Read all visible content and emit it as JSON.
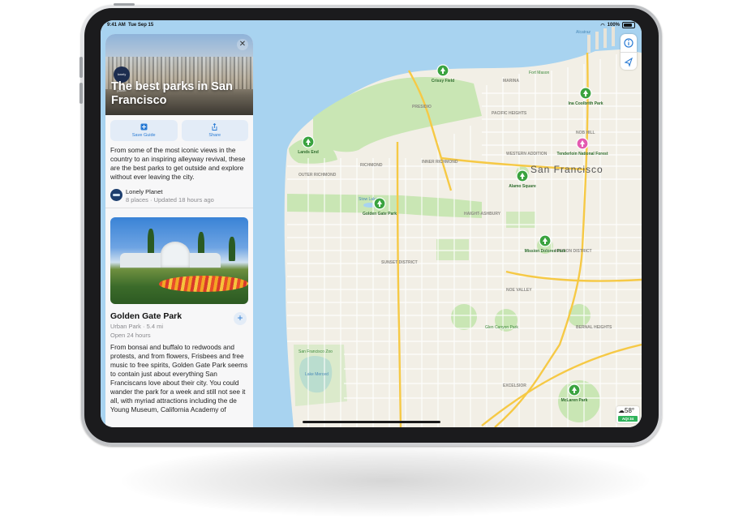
{
  "status": {
    "time": "9:41 AM",
    "date": "Tue Sep 15",
    "battery": "100%"
  },
  "guide": {
    "publisher_logo": "lonely planet",
    "title": "The best parks in San Francisco",
    "close_icon": "close-icon",
    "save_label": "Save Guide",
    "share_label": "Share",
    "description": "From some of the most iconic views in the country to an inspiring alleyway revival, these are the best parks to get outside and explore without ever leaving the city.",
    "author": "Lonely Planet",
    "meta": "8 places · Updated 18 hours ago"
  },
  "place": {
    "name": "Golden Gate Park",
    "type": "Urban Park · 5.4 mi",
    "hours": "Open 24 hours",
    "description": "From bonsai and buffalo to redwoods and protests, and from flowers, Frisbees and free music to free spirits, Golden Gate Park seems to contain just about everything San Franciscans love about their city. You could wander the park for a week and still not see it all, with myriad attractions including the de Young Museum, California Academy of"
  },
  "map": {
    "city": "San Francisco",
    "parks": [
      {
        "name": "Crissy Field"
      },
      {
        "name": "Lands End"
      },
      {
        "name": "Golden Gate Park"
      },
      {
        "name": "Alamo Square"
      },
      {
        "name": "Ina Coolbrith Park"
      },
      {
        "name": "Tenderloin National Forest"
      },
      {
        "name": "Mission Dolores Park"
      },
      {
        "name": "McLaren Park"
      }
    ],
    "labels": {
      "fort_mason": "Fort Mason",
      "marina": "MARINA",
      "presidio": "PRESIDIO",
      "richmond": "RICHMOND",
      "outer_richmond": "OUTER RICHMOND",
      "inner_richmond": "INNER RICHMOND",
      "sunset": "SUNSET DISTRICT",
      "haight": "HAIGHT-ASHBURY",
      "mission": "MISSION DISTRICT",
      "nob_hill": "NOB HILL",
      "pacific_heights": "PACIFIC HEIGHTS",
      "western_addition": "WESTERN ADDITION",
      "noe_valley": "NOE VALLEY",
      "bernal": "BERNAL HEIGHTS",
      "excelsior": "EXCELSIOR",
      "lake_merced": "Lake Merced",
      "stow_lake": "Stow Lake",
      "glen_canyon": "Glen Canyon Park",
      "sf_zoo": "San Francisco Zoo",
      "alcatraz": "Alcatraz"
    },
    "weather": {
      "temp": "58°",
      "aqi": "AQI 34"
    }
  },
  "colors": {
    "accent": "#2a7bd4",
    "park_pin": "#3aa33f",
    "water": "#a8d3f0",
    "park": "#c9e6b4",
    "road": "#f6c945"
  }
}
